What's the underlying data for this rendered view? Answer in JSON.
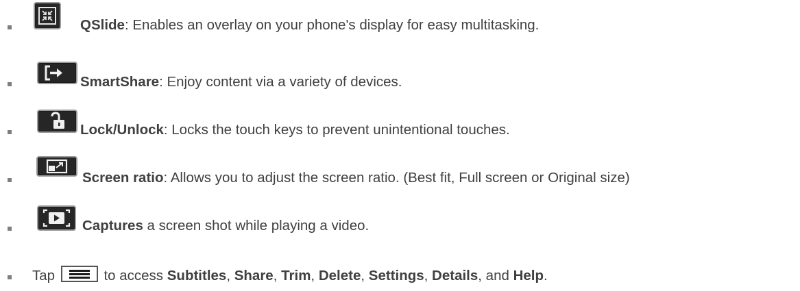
{
  "items": [
    {
      "icon": "qslide-icon",
      "title": "QSlide",
      "desc": ": Enables an overlay on your phone's display for easy multitasking."
    },
    {
      "icon": "smartshare-icon",
      "title": "SmartShare",
      "desc": ": Enjoy content via a variety of devices."
    },
    {
      "icon": "lock-icon",
      "title": "Lock/Unlock",
      "desc": ": Locks the touch keys to prevent unintentional touches."
    },
    {
      "icon": "screen-ratio-icon",
      "title": "Screen ratio",
      "desc": ": Allows you to adjust the screen ratio. (Best fit, Full screen or Original size)"
    },
    {
      "icon": "capture-icon",
      "title": "Captures",
      "desc": " a screen shot while playing a video."
    }
  ],
  "last_item": {
    "prefix": "Tap ",
    "icon": "menu-icon",
    "middle": " to access ",
    "subtitles": "Subtitles",
    "sep1": ", ",
    "share": "Share",
    "sep2": ", ",
    "trim": "Trim",
    "sep3": ", ",
    "delete": "Delete",
    "sep4": ", ",
    "settings": "Settings",
    "sep5": ", ",
    "details": "Details",
    "sep6": ", and ",
    "help": "Help",
    "end": "."
  }
}
